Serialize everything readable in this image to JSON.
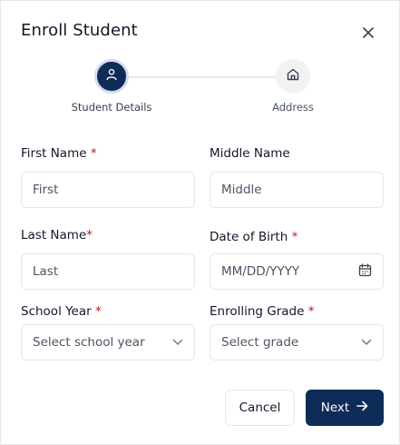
{
  "dialog": {
    "title": "Enroll Student"
  },
  "stepper": {
    "steps": [
      {
        "label": "Student Details",
        "icon": "user-icon",
        "state": "active"
      },
      {
        "label": "Address",
        "icon": "home-icon",
        "state": "inactive"
      }
    ]
  },
  "form": {
    "first_name": {
      "label": "First Name",
      "required_mark": "*",
      "placeholder": "First"
    },
    "middle_name": {
      "label": "Middle Name",
      "placeholder": "Middle"
    },
    "last_name": {
      "label": "Last Name",
      "required_mark": "*",
      "placeholder": "Last"
    },
    "date_of_birth": {
      "label": "Date of Birth",
      "required_mark": "*",
      "placeholder": "MM/DD/YYYY",
      "icon": "calendar-icon"
    },
    "school_year": {
      "label": "School Year",
      "required_mark": "*",
      "selected": "Select school year",
      "icon": "chevron-down-icon"
    },
    "enrolling_grade": {
      "label": "Enrolling Grade",
      "required_mark": "*",
      "selected": "Select grade",
      "icon": "chevron-down-icon"
    }
  },
  "actions": {
    "cancel_label": "Cancel",
    "next_label": "Next",
    "next_icon": "arrow-right-icon"
  },
  "colors": {
    "primary": "#0f2b57",
    "required": "#b91c1c",
    "border": "#e5e7eb"
  }
}
